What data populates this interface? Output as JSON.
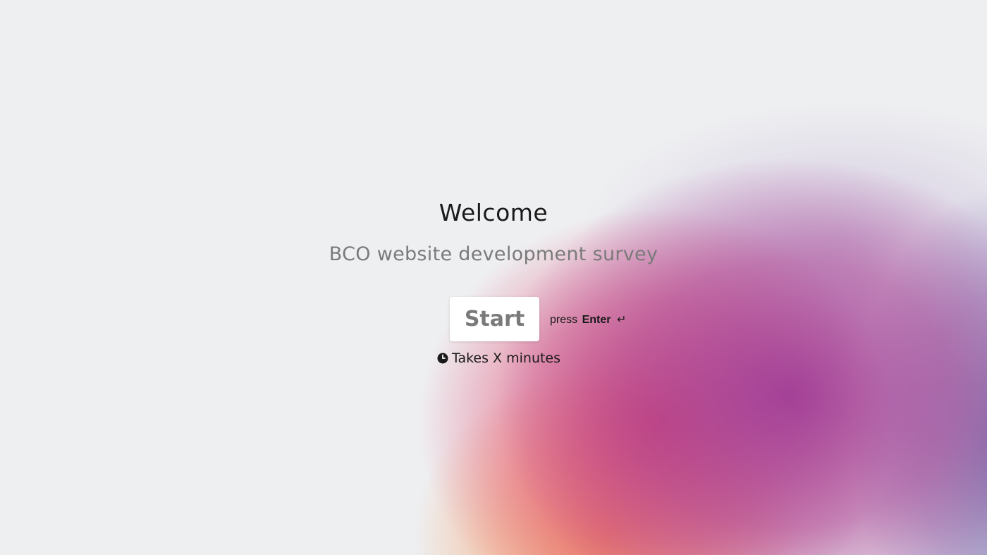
{
  "welcome": {
    "title": "Welcome",
    "subtitle": "BCO website development survey",
    "start_button_label": "Start",
    "hint_prefix": "press",
    "hint_key": "Enter",
    "hint_icon": "↵",
    "duration_icon": "clock-icon",
    "duration_text": "Takes X minutes"
  },
  "colors": {
    "background": "#eeeff1",
    "button_bg": "#ffffff",
    "button_text": "#7a7a7a",
    "title_text": "#1a1a1a",
    "subtitle_text": "#7a7a7a",
    "gradient": [
      "#f0965a",
      "#e14169",
      "#a03c96",
      "#6e78af"
    ]
  }
}
